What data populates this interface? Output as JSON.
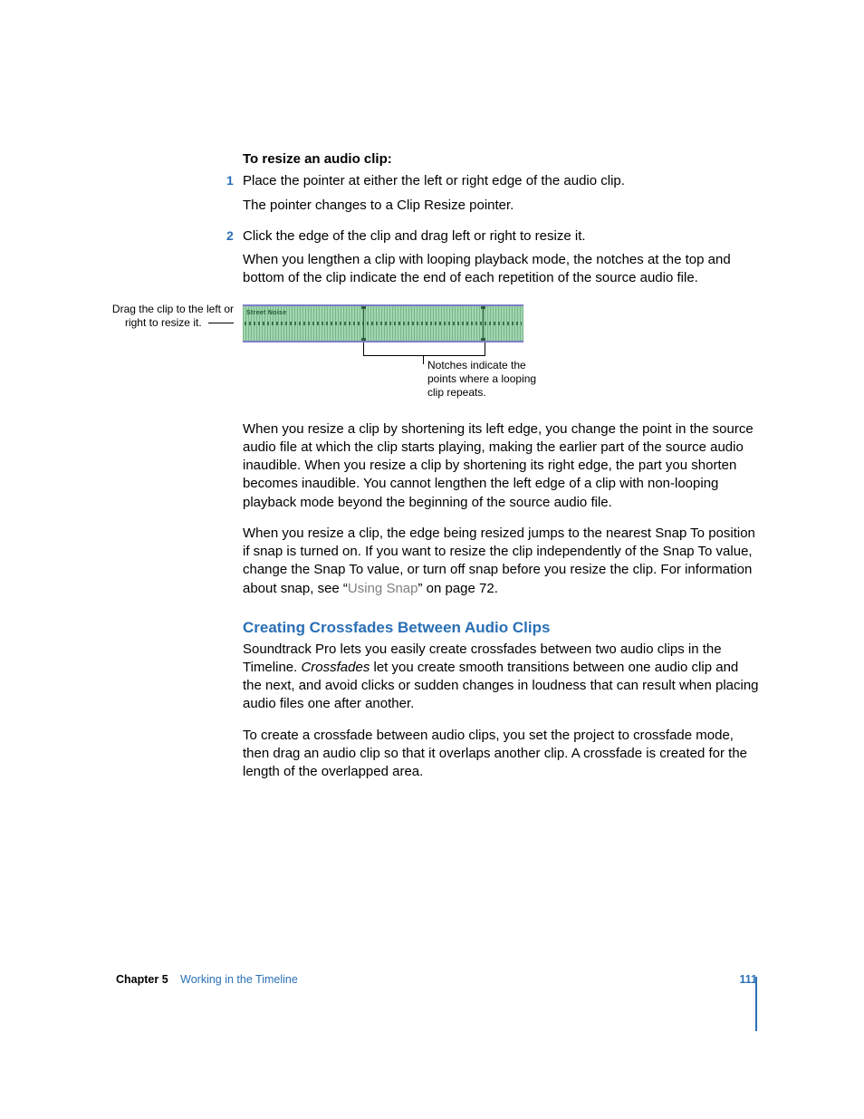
{
  "heading": "To resize an audio clip:",
  "steps": {
    "s1_num": "1",
    "s1_text": "Place the pointer at either the left or right edge of the audio clip.",
    "s1_follow": "The pointer changes to a Clip Resize pointer.",
    "s2_num": "2",
    "s2_text": "Click the edge of the clip and drag left or right to resize it.",
    "s2_follow": "When you lengthen a clip with looping playback mode, the notches at the top and bottom of the clip indicate the end of each repetition of the source audio file."
  },
  "figure": {
    "left_callout": "Drag the clip to the left or right to resize it.",
    "clip_label": "Street Noise",
    "bottom_callout": "Notches indicate the points where a looping clip repeats."
  },
  "para_resize_left": "When you resize a clip by shortening its left edge, you change the point in the source audio file at which the clip starts playing, making the earlier part of the source audio inaudible. When you resize a clip by shortening its right edge, the part you shorten becomes inaudible. You cannot lengthen the left edge of a clip with non-looping playback mode beyond the beginning of the source audio file.",
  "para_snap_pre": "When you resize a clip, the edge being resized jumps to the nearest Snap To position if snap is turned on. If you want to resize the clip independently of the Snap To value, change the Snap To value, or turn off snap before you resize the clip. For information about snap, see “",
  "para_snap_link": "Using Snap",
  "para_snap_post": "” on page 72.",
  "section_title": "Creating Crossfades Between Audio Clips",
  "section_para1_a": "Soundtrack Pro lets you easily create crossfades between two audio clips in the Timeline. ",
  "section_para1_italic": "Crossfades",
  "section_para1_b": " let you create smooth transitions between one audio clip and the next, and avoid clicks or sudden changes in loudness that can result when placing audio files one after another.",
  "section_para2": "To create a crossfade between audio clips, you set the project to crossfade mode, then drag an audio clip so that it overlaps another clip. A crossfade is created for the length of the overlapped area.",
  "footer": {
    "chapter_label": "Chapter 5",
    "chapter_title": "Working in the Timeline",
    "page_num": "111"
  }
}
